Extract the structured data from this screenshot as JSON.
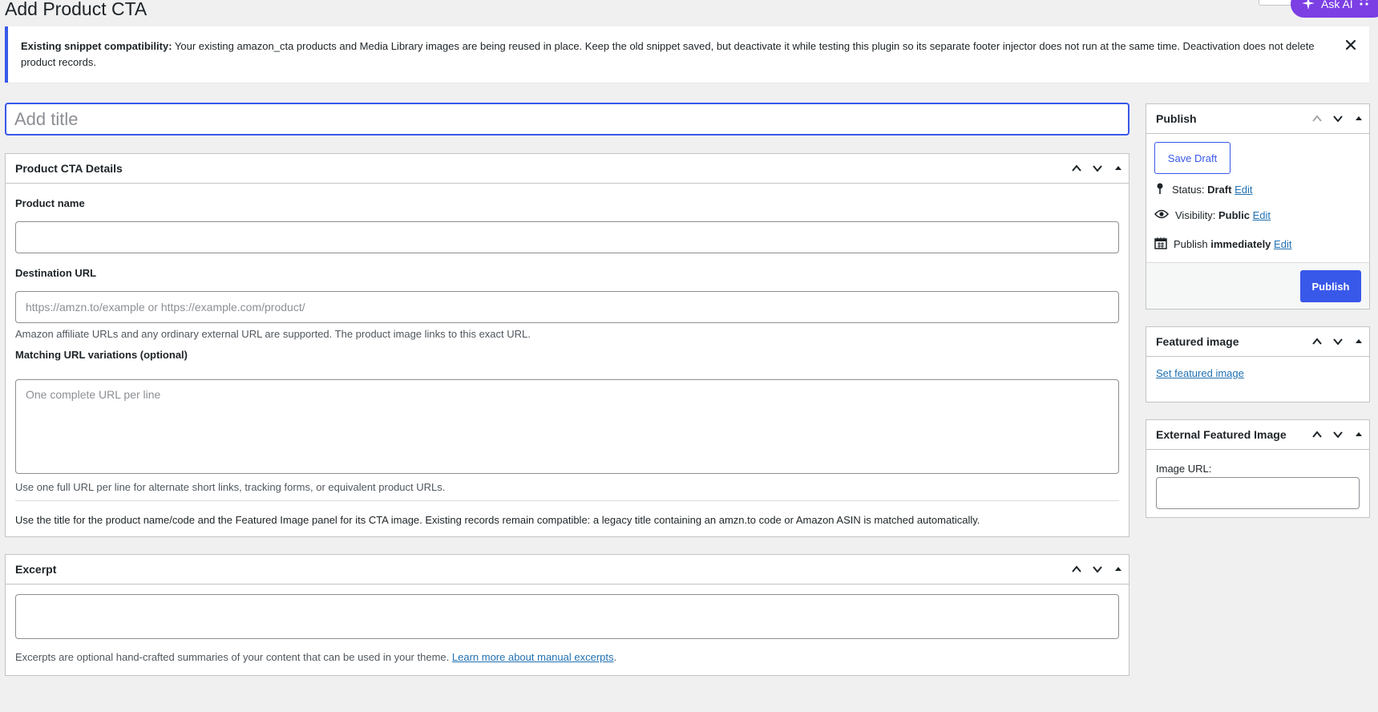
{
  "page": {
    "title": "Add Product CTA"
  },
  "topbar": {
    "ask_ai": "Ask AI"
  },
  "notice": {
    "strong": "Existing snippet compatibility:",
    "text": " Your existing amazon_cta products and Media Library images are being reused in place. Keep the old snippet saved, but deactivate it while testing this plugin so its separate footer injector does not run at the same time. Deactivation does not delete product records.",
    "dismiss": "✕"
  },
  "title_field": {
    "placeholder": "Add title",
    "value": ""
  },
  "details": {
    "heading": "Product CTA Details",
    "product_name_label": "Product name",
    "product_name_value": "",
    "destination_label": "Destination URL",
    "destination_placeholder": "https://amzn.to/example or https://example.com/product/",
    "destination_desc": "Amazon affiliate URLs and any ordinary external URL are supported. The product image links to this exact URL.",
    "variations_label": "Matching URL variations (optional)",
    "variations_placeholder": "One complete URL per line",
    "variations_desc": "Use one full URL per line for alternate short links, tracking forms, or equivalent product URLs.",
    "footer_note": "Use the title for the product name/code and the Featured Image panel for its CTA image. Existing records remain compatible: a legacy title containing an amzn.to code or Amazon ASIN is matched automatically."
  },
  "excerpt": {
    "heading": "Excerpt",
    "value": "",
    "desc": "Excerpts are optional hand-crafted summaries of your content that can be used in your theme.",
    "link": "Learn more about manual excerpts",
    "period": "."
  },
  "publish": {
    "heading": "Publish",
    "save_draft": "Save Draft",
    "status_label": "Status:",
    "status_value": "Draft",
    "visibility_label": "Visibility:",
    "visibility_value": "Public",
    "schedule_label": "Publish",
    "schedule_value": "immediately",
    "edit": "Edit",
    "publish_button": "Publish"
  },
  "featured": {
    "heading": "Featured image",
    "link": "Set featured image"
  },
  "external": {
    "heading": "External Featured Image",
    "label": "Image URL:",
    "value": ""
  },
  "colors": {
    "accent": "#3858e9",
    "link": "#2271b1",
    "ai": "#7b3fe4",
    "border": "#c3c4c7"
  }
}
